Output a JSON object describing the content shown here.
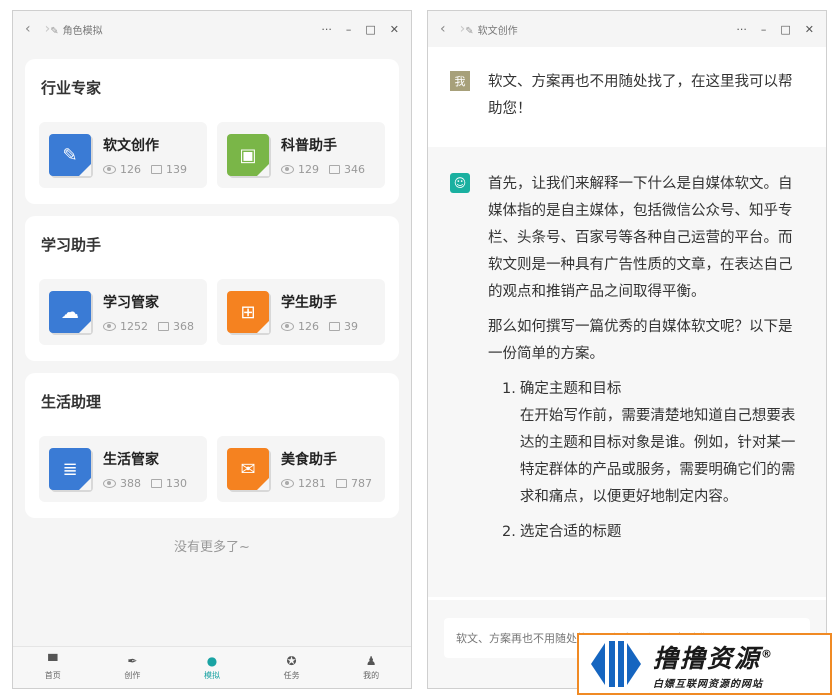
{
  "left_window": {
    "title": "角色模拟",
    "nav": {
      "back": "‹",
      "forward": "›"
    },
    "controls": {
      "more": "···",
      "minimize": "–",
      "maximize": "□",
      "close": "✕"
    },
    "sections": [
      {
        "title": "行业专家",
        "cards": [
          {
            "name": "软文创作",
            "views": "126",
            "comments": "139",
            "color": "#3a7bd5",
            "icon": "edit-image-icon",
            "glyph": "✎"
          },
          {
            "name": "科普助手",
            "views": "129",
            "comments": "346",
            "color": "#7ab648",
            "icon": "picture-icon",
            "glyph": "▣"
          }
        ]
      },
      {
        "title": "学习助手",
        "cards": [
          {
            "name": "学习管家",
            "views": "1252",
            "comments": "368",
            "color": "#3a7bd5",
            "icon": "chat-bubbles-icon",
            "glyph": "☁"
          },
          {
            "name": "学生助手",
            "views": "126",
            "comments": "39",
            "color": "#f58220",
            "icon": "gift-icon",
            "glyph": "⊞"
          }
        ]
      },
      {
        "title": "生活助理",
        "cards": [
          {
            "name": "生活管家",
            "views": "388",
            "comments": "130",
            "color": "#3a7bd5",
            "icon": "document-icon",
            "glyph": "≣"
          },
          {
            "name": "美食助手",
            "views": "1281",
            "comments": "787",
            "color": "#f58220",
            "icon": "note-edit-icon",
            "glyph": "✉"
          }
        ]
      }
    ],
    "no_more": "没有更多了~",
    "tabs": [
      {
        "label": "首页",
        "icon": "home-icon",
        "glyph": "▀"
      },
      {
        "label": "创作",
        "icon": "feather-icon",
        "glyph": "✒"
      },
      {
        "label": "模拟",
        "icon": "globe-icon",
        "glyph": "●"
      },
      {
        "label": "任务",
        "icon": "badge-icon",
        "glyph": "✪"
      },
      {
        "label": "我的",
        "icon": "user-icon",
        "glyph": "♟"
      }
    ],
    "active_tab": "模拟"
  },
  "right_window": {
    "title": "软文创作",
    "user_avatar": "我",
    "user_message": "软文、方案再也不用随处找了，在这里我可以帮助您！",
    "bot_paragraphs": [
      "首先，让我们来解释一下什么是自媒体软文。自媒体指的是自主媒体，包括微信公众号、知乎专栏、头条号、百家号等各种自己运营的平台。而软文则是一种具有广告性质的文章，在表达自己的观点和推销产品之间取得平衡。",
      "那么如何撰写一篇优秀的自媒体软文呢？以下是一份简单的方案。"
    ],
    "bot_list": [
      {
        "num": "1.",
        "title": "确定主题和目标",
        "body": "在开始写作前，需要清楚地知道自己想要表达的主题和目标对象是谁。例如，针对某一特定群体的产品或服务，需要明确它们的需求和痛点，以便更好地制定内容。"
      },
      {
        "num": "2.",
        "title": "选定合适的标题",
        "body": ""
      }
    ],
    "input_placeholder": "软文、方案再也不用随处找了，在这里我可以帮助您！"
  },
  "watermark": {
    "main": "撸撸资源",
    "reg": "®",
    "sub": "白嫖互联网资源的网站"
  }
}
